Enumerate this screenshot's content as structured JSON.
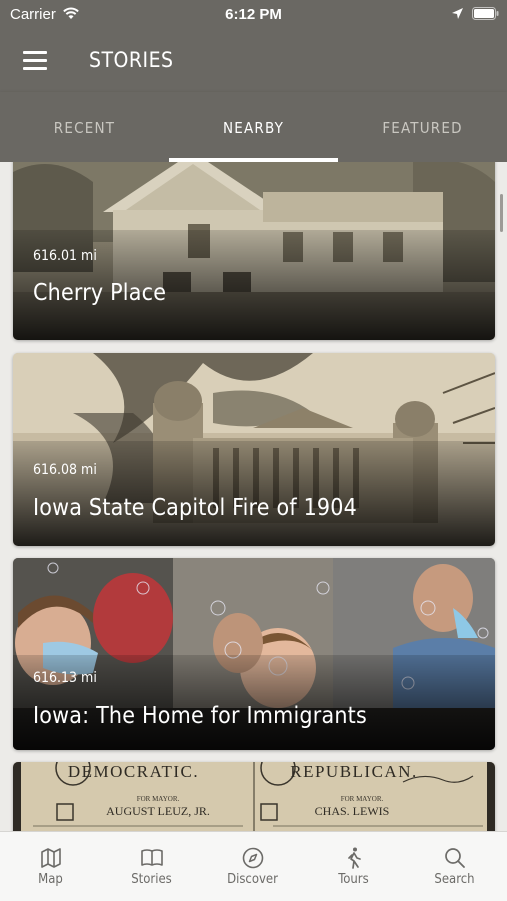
{
  "status_bar": {
    "carrier": "Carrier",
    "time": "6:12 PM"
  },
  "header": {
    "title": "STORIES",
    "menu_icon": "hamburger-menu-icon"
  },
  "tabs": [
    {
      "label": "RECENT",
      "active": false
    },
    {
      "label": "NEARBY",
      "active": true
    },
    {
      "label": "FEATURED",
      "active": false
    }
  ],
  "stories": [
    {
      "distance": "616.01 mi",
      "title": "Cherry Place"
    },
    {
      "distance": "616.08 mi",
      "title": "Iowa State Capitol Fire of 1904"
    },
    {
      "distance": "616.13 mi",
      "title": "Iowa: The Home for Immigrants"
    },
    {
      "ballot_left": "DEMOCRATIC.",
      "ballot_right": "REPUBLICAN.",
      "mayor_left": "AUGUST LEUZ, JR.",
      "mayor_right": "CHAS. LEWIS",
      "for_mayor": "FOR MAYOR."
    }
  ],
  "tab_bar": [
    {
      "label": "Map",
      "icon": "map-icon"
    },
    {
      "label": "Stories",
      "icon": "book-icon"
    },
    {
      "label": "Discover",
      "icon": "compass-icon"
    },
    {
      "label": "Tours",
      "icon": "walking-person-icon"
    },
    {
      "label": "Search",
      "icon": "search-icon"
    }
  ],
  "colors": {
    "header": "#6a6863",
    "background": "#ecebe8",
    "tabbar": "#f7f7f6"
  }
}
